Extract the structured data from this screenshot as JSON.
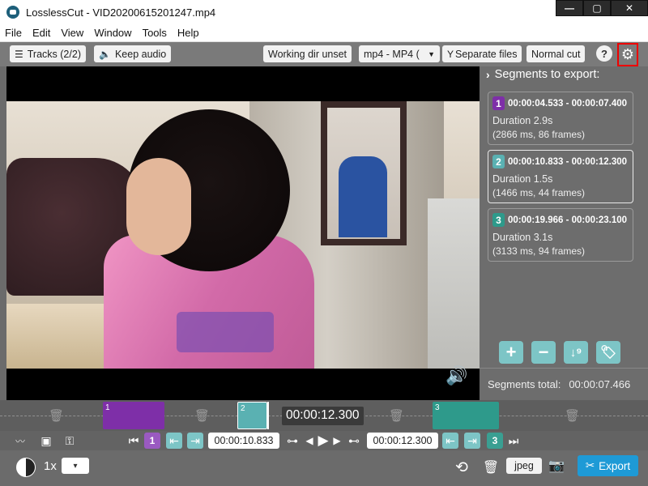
{
  "window": {
    "title": "LosslessCut - VID20200615201247.mp4",
    "minimize": "—",
    "maximize": "▢",
    "close": "✕"
  },
  "menu": [
    "File",
    "Edit",
    "View",
    "Window",
    "Tools",
    "Help"
  ],
  "toolbar": {
    "tracks_label": "Tracks (2/2)",
    "audio_label": "Keep audio",
    "workdir_label": "Working dir unset",
    "format_value": "mp4 - MP4 (",
    "separate_label": "Separate files",
    "cut_mode_label": "Normal cut",
    "help_label": "?"
  },
  "segments_panel": {
    "header": "Segments to export:",
    "segments": [
      {
        "index": "1",
        "range": "00:00:04.533 - 00:00:07.400",
        "duration": "Duration 2.9s",
        "frames": "(2866 ms, 86 frames)",
        "color": "#7e2fa8"
      },
      {
        "index": "2",
        "range": "00:00:10.833 - 00:00:12.300",
        "duration": "Duration 1.5s",
        "frames": "(1466 ms, 44 frames)",
        "color": "#5ab1b2"
      },
      {
        "index": "3",
        "range": "00:00:19.966 - 00:00:23.100",
        "duration": "Duration 3.1s",
        "frames": "(3133 ms, 94 frames)",
        "color": "#2e9a8b"
      }
    ],
    "total_label": "Segments total:",
    "total_value": "00:00:07.466"
  },
  "timeline": {
    "current_time": "00:00:12.300",
    "segment_labels": [
      "1",
      "2",
      "3"
    ]
  },
  "controls": {
    "start_time": "00:00:10.833",
    "end_time": "00:00:12.300",
    "prev_segment_label": "1",
    "next_segment_label": "3"
  },
  "bottombar": {
    "speed": "1x",
    "snapshot_format": "jpeg",
    "export_label": "Export"
  },
  "colors": {
    "accent": "#1e9ad6",
    "teal": "#7dc5c6",
    "purple": "#9a5ac1",
    "highlight": "#e00000"
  }
}
